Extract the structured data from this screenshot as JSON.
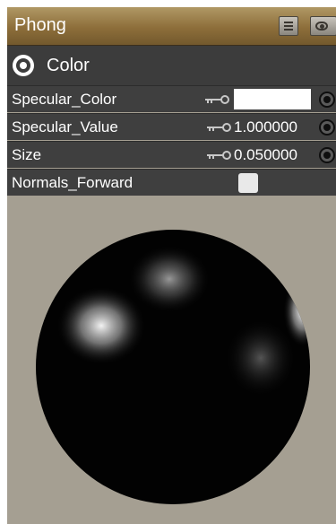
{
  "panel": {
    "title": "Phong",
    "list_button_icon": "list-icon",
    "visibility_button_icon": "eye-icon"
  },
  "section": {
    "label": "Color",
    "icon": "collapse-toggle-icon"
  },
  "properties": [
    {
      "label": "Specular_Color",
      "type": "color",
      "value_color": "#ffffff"
    },
    {
      "label": "Specular_Value",
      "type": "number",
      "value": "1.000000"
    },
    {
      "label": "Size",
      "type": "number",
      "value": "0.050000"
    },
    {
      "label": "Normals_Forward",
      "type": "checkbox",
      "checked": false
    }
  ],
  "colors": {
    "title_bar": "#8d6e3a",
    "row_background": "#3f3f3f",
    "preview_background": "#a59f92",
    "sphere": "#000000",
    "highlight": "#ffffff"
  }
}
